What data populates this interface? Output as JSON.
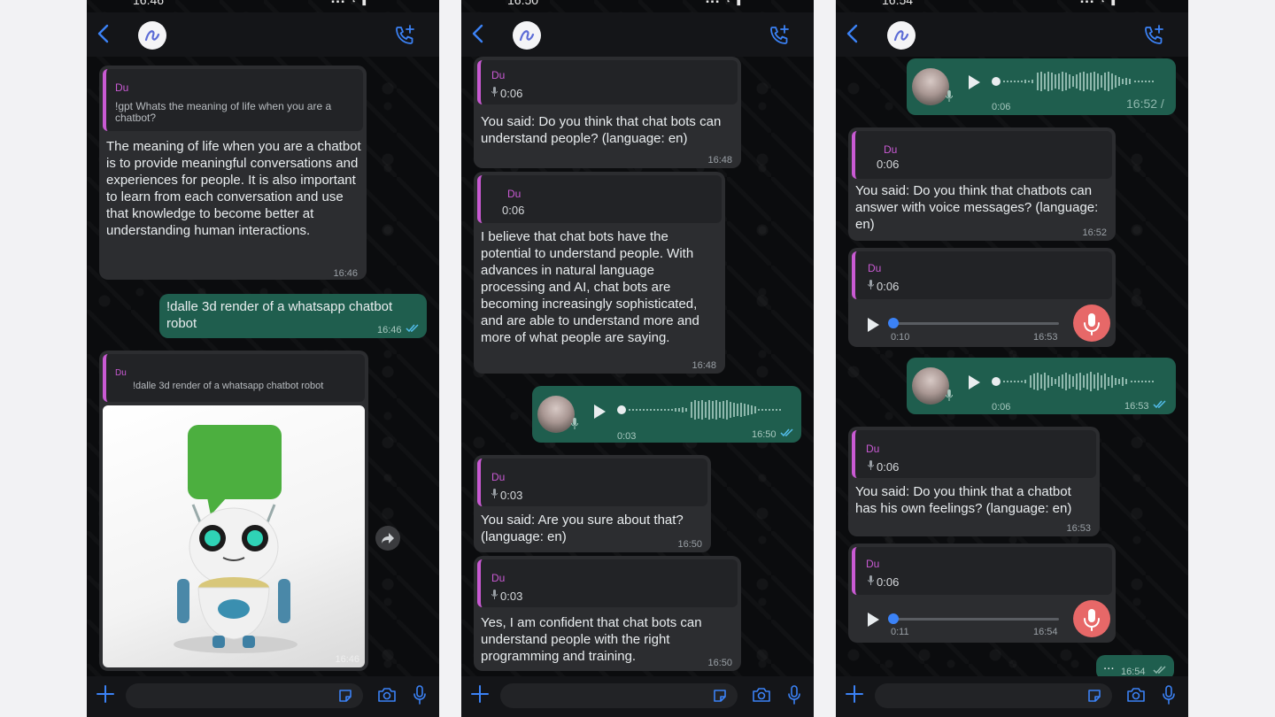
{
  "screens": [
    {
      "status_time": "16:46",
      "messages": {
        "m1": {
          "sender": "Du",
          "quote": "!gpt Whats the meaning of life when you are a chatbot?",
          "text": "The meaning of life when you are a chatbot is to provide meaningful conversations and experiences for people. It is also important to learn from each conversation and use that knowledge to become better at understanding human interactions.",
          "time": "16:46"
        },
        "m2": {
          "text": "!dalle 3d render of a whatsapp chatbot robot",
          "time": "16:46"
        },
        "m3": {
          "sender": "Du",
          "quote": "!dalle 3d render of a whatsapp chatbot robot",
          "time": "16:46"
        }
      }
    },
    {
      "status_time": "16:50",
      "messages": {
        "m1": {
          "sender": "Du",
          "duration": "0:06",
          "text": "You said: Do you think that chat bots can understand people? (language: en)",
          "time": "16:48"
        },
        "m2": {
          "sender": "Du",
          "duration": "0:06",
          "text": "I believe that chat bots have the potential to understand people. With advances in natural language processing and AI, chat bots are becoming increasingly sophisticated, and are able to understand more and more of what people are saying.",
          "time": "16:48"
        },
        "m3": {
          "duration": "0:03",
          "time": "16:50"
        },
        "m4": {
          "sender": "Du",
          "duration": "0:03",
          "text": "You said: Are you sure about that? (language: en)",
          "time": "16:50"
        },
        "m5": {
          "sender": "Du",
          "duration": "0:03",
          "text": "Yes, I am confident that chat bots can understand people with the right programming and training.",
          "time": "16:50"
        }
      }
    },
    {
      "status_time": "16:54",
      "messages": {
        "m1": {
          "duration": "0:06",
          "time": "16:52 /"
        },
        "m2": {
          "sender": "Du",
          "duration": "0:06",
          "text": "You said: Do you think that chatbots can answer with voice messages? (language: en)",
          "time": "16:52"
        },
        "m3": {
          "sender": "Du",
          "duration": "0:06",
          "elapsed": "0:10",
          "time": "16:53"
        },
        "m4": {
          "duration": "0:06",
          "time": "16:53"
        },
        "m5": {
          "sender": "Du",
          "duration": "0:06",
          "text": "You said: Do you think that a chatbot has his own feelings? (language: en)",
          "time": "16:53"
        },
        "m6": {
          "sender": "Du",
          "duration": "0:06",
          "elapsed": "0:11",
          "time": "16:54"
        },
        "m7": {
          "text": "...",
          "time": "16:54"
        }
      }
    }
  ],
  "icons": [
    "back-chevron-icon",
    "bot-avatar-icon",
    "call-add-icon",
    "plus-icon",
    "sticker-icon",
    "camera-icon",
    "microphone-icon",
    "play-icon",
    "double-check-icon",
    "forward-icon"
  ],
  "colors": {
    "incoming": "#2c2d30",
    "outgoing": "#1f5e4e",
    "quote_accent": "#c95ad3",
    "link_blue": "#3b82f6",
    "record_red": "#e76868"
  }
}
